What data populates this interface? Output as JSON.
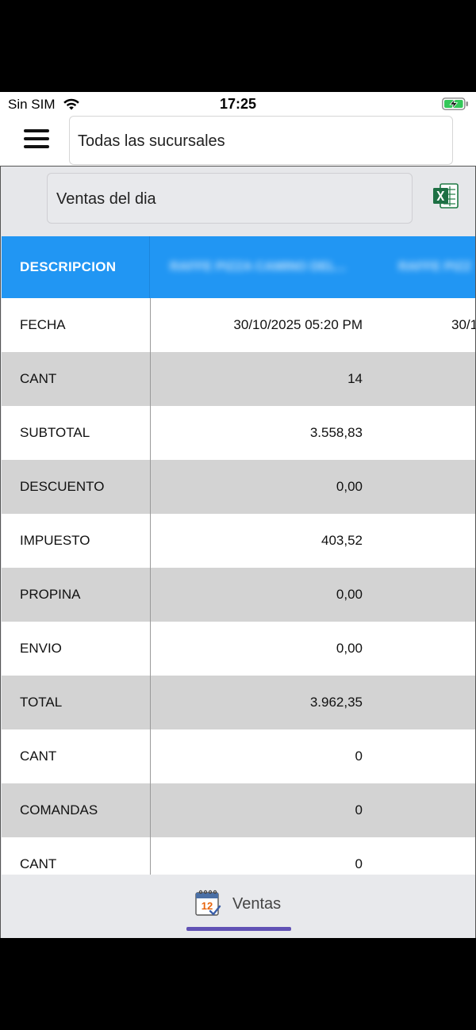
{
  "status_bar": {
    "carrier": "Sin SIM",
    "time": "17:25"
  },
  "header": {
    "branch_selected": "Todas las sucursales"
  },
  "report": {
    "selected": "Ventas del dia"
  },
  "table": {
    "header_label": "DESCRIPCION",
    "columns": [
      {
        "title": "RAFFE PIZZA CAMINO DEL..."
      },
      {
        "title": "RAFFE PIZZ"
      }
    ],
    "rows": [
      {
        "label": "FECHA",
        "values": [
          "30/10/2025 05:20 PM",
          "30/1"
        ]
      },
      {
        "label": "CANT",
        "values": [
          "14",
          ""
        ]
      },
      {
        "label": "SUBTOTAL",
        "values": [
          "3.558,83",
          ""
        ]
      },
      {
        "label": "DESCUENTO",
        "values": [
          "0,00",
          ""
        ]
      },
      {
        "label": "IMPUESTO",
        "values": [
          "403,52",
          ""
        ]
      },
      {
        "label": "PROPINA",
        "values": [
          "0,00",
          ""
        ]
      },
      {
        "label": "ENVIO",
        "values": [
          "0,00",
          ""
        ]
      },
      {
        "label": "TOTAL",
        "values": [
          "3.962,35",
          ""
        ]
      },
      {
        "label": "CANT",
        "values": [
          "0",
          ""
        ]
      },
      {
        "label": "COMANDAS",
        "values": [
          "0",
          ""
        ]
      },
      {
        "label": "CANT",
        "values": [
          "0",
          ""
        ]
      }
    ]
  },
  "tab_bar": {
    "ventas_label": "Ventas",
    "calendar_number": "12"
  },
  "colors": {
    "header_blue": "#2196f3",
    "tab_indicator": "#6152b5",
    "row_alt": "#d3d3d3"
  },
  "icons": [
    "wifi-icon",
    "battery-charging-icon",
    "menu-icon",
    "excel-icon",
    "calendar-icon"
  ]
}
